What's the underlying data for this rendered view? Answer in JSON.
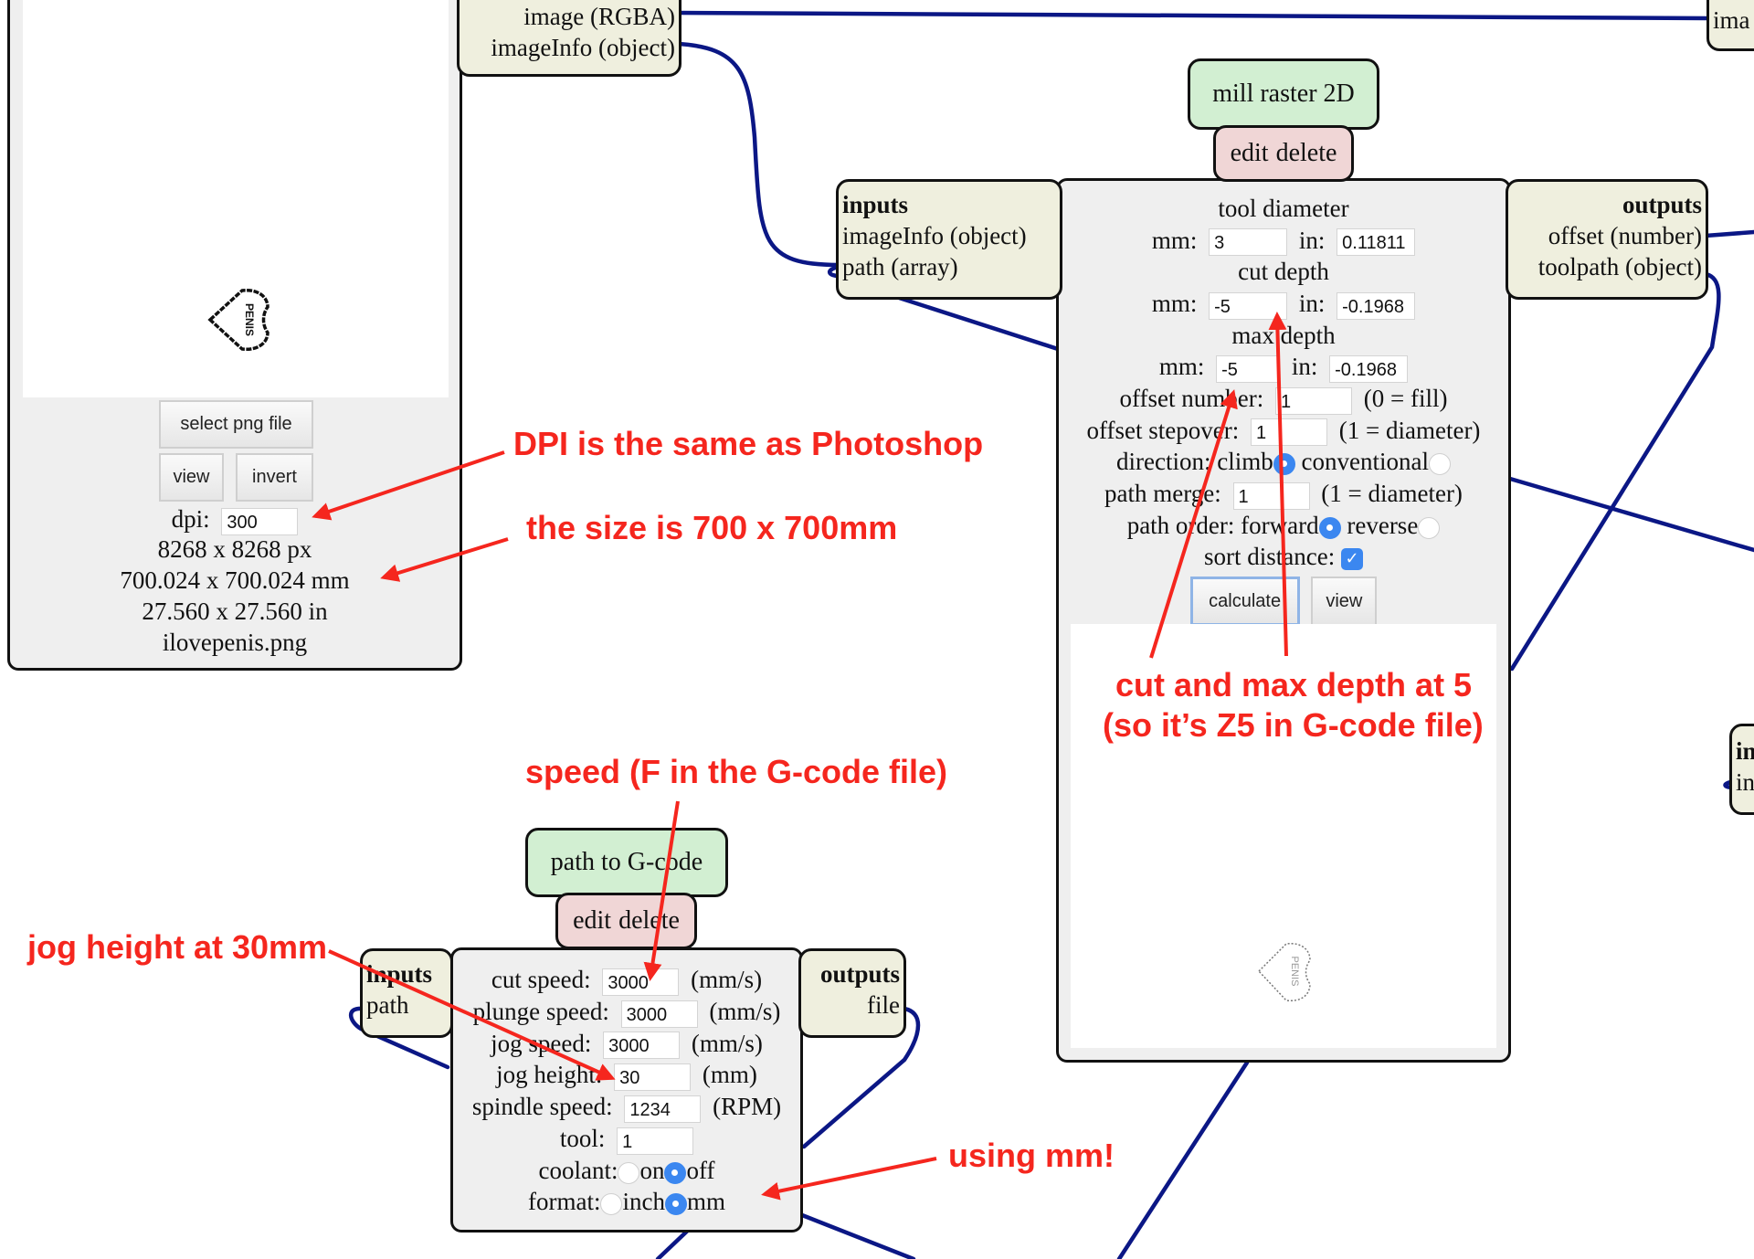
{
  "colors": {
    "wire": "#0b1785",
    "annotation": "#f5261e",
    "port_bg": "#efefde",
    "title_bg": "#d2efd2",
    "edit_bg": "#f0d6d6",
    "panel_bg": "#efefef",
    "radio_selected": "#3b87f0"
  },
  "image_module": {
    "outputs": [
      "image (RGBA)",
      "imageInfo (object)"
    ],
    "preview_icon": "heart-stamp-icon",
    "select_button": "select png file",
    "view_button": "view",
    "invert_button": "invert",
    "dpi_label": "dpi:",
    "dpi_value": "300",
    "size_px": "8268 x 8268 px",
    "size_mm": "700.024 x 700.024 mm",
    "size_in": "27.560 x 27.560 in",
    "filename": "ilovepenis.png"
  },
  "mill_raster": {
    "title": "mill raster 2D",
    "edit_label": "edit",
    "delete_label": "delete",
    "inputs_header": "inputs",
    "inputs": [
      "imageInfo (object)",
      "path (array)"
    ],
    "outputs_header": "outputs",
    "outputs": [
      "offset (number)",
      "toolpath (object)"
    ],
    "tool_diameter": {
      "heading": "tool diameter",
      "mm_label": "mm:",
      "mm": "3",
      "in_label": "in:",
      "in": "0.11811"
    },
    "cut_depth": {
      "heading": "cut depth",
      "mm_label": "mm:",
      "mm": "-5",
      "in_label": "in:",
      "in": "-0.1968"
    },
    "max_depth": {
      "heading": "max depth",
      "mm_label": "mm:",
      "mm": "-5",
      "in_label": "in:",
      "in": "-0.1968"
    },
    "offset_number": {
      "label": "offset number:",
      "value": "1",
      "hint": "(0 = fill)"
    },
    "offset_stepover": {
      "label": "offset stepover:",
      "value": "1",
      "hint": "(1 = diameter)"
    },
    "direction": {
      "label": "direction:",
      "option_a": "climb",
      "option_b": "conventional",
      "selected": "climb"
    },
    "path_merge": {
      "label": "path merge:",
      "value": "1",
      "hint": "(1 = diameter)"
    },
    "path_order": {
      "label": "path order:",
      "option_a": "forward",
      "option_b": "reverse",
      "selected": "forward"
    },
    "sort_distance": {
      "label": "sort distance:",
      "checked": true
    },
    "calculate_button": "calculate",
    "view_button": "view",
    "preview_icon": "toolpath-heart-icon"
  },
  "gcode": {
    "title": "path to G-code",
    "edit_label": "edit",
    "delete_label": "delete",
    "inputs_header": "inputs",
    "inputs": [
      "path"
    ],
    "outputs_header": "outputs",
    "outputs": [
      "file"
    ],
    "cut_speed": {
      "label": "cut speed:",
      "value": "3000",
      "unit": "(mm/s)"
    },
    "plunge_speed": {
      "label": "plunge speed:",
      "value": "3000",
      "unit": "(mm/s)"
    },
    "jog_speed": {
      "label": "jog speed:",
      "value": "3000",
      "unit": "(mm/s)"
    },
    "jog_height": {
      "label": "jog height:",
      "value": "30",
      "unit": "(mm)"
    },
    "spindle_speed": {
      "label": "spindle speed:",
      "value": "1234",
      "unit": "(RPM)"
    },
    "tool": {
      "label": "tool:",
      "value": "1"
    },
    "coolant": {
      "label": "coolant:",
      "option_a": "on",
      "option_b": "off",
      "selected": "off"
    },
    "format": {
      "label": "format:",
      "option_a": "inch",
      "option_b": "mm",
      "selected": "mm"
    }
  },
  "edge_nodes": {
    "top_right": {
      "text": "ima"
    },
    "mid_right": {
      "line1": "in",
      "line2": "in"
    }
  },
  "annotations": {
    "dpi": "DPI is the same as Photoshop",
    "size": "the size is 700 x 700mm",
    "depth_line1": "cut and max depth at 5",
    "depth_line2": "(so it’s Z5 in G-code file)",
    "speed": "speed (F in the G-code file)",
    "jog": "jog height at 30mm",
    "units": "using mm!"
  }
}
